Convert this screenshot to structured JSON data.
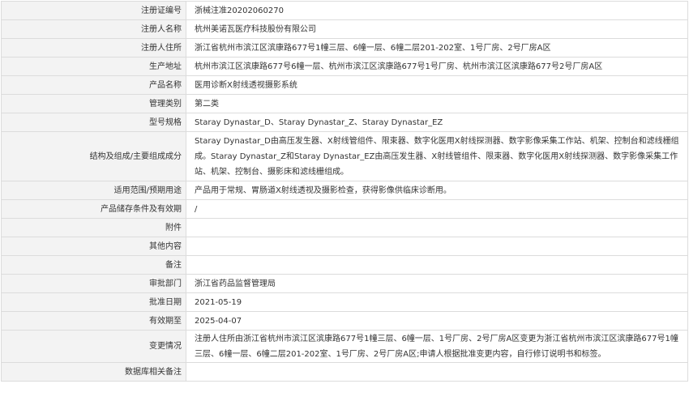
{
  "rows": [
    {
      "label": "注册证编号",
      "value": "浙械注准20202060270"
    },
    {
      "label": "注册人名称",
      "value": "杭州美诺瓦医疗科技股份有限公司"
    },
    {
      "label": "注册人住所",
      "value": "浙江省杭州市滨江区滨康路677号1幢三层、6幢一层、6幢二层201-202室、1号厂房、2号厂房A区"
    },
    {
      "label": "生产地址",
      "value": "杭州市滨江区滨康路677号6幢一层、杭州市滨江区滨康路677号1号厂房、杭州市滨江区滨康路677号2号厂房A区"
    },
    {
      "label": "产品名称",
      "value": "医用诊断X射线透视摄影系统"
    },
    {
      "label": "管理类别",
      "value": "第二类"
    },
    {
      "label": "型号规格",
      "value": "Staray Dynastar_D、Staray Dynastar_Z、Staray Dynastar_EZ"
    },
    {
      "label": "结构及组成/主要组成成分",
      "value": "Staray Dynastar_D由高压发生器、X射线管组件、限束器、数字化医用X射线探测器、数字影像采集工作站、机架、控制台和滤线栅组成。Staray Dynastar_Z和Staray Dynastar_EZ由高压发生器、X射线管组件、限束器、数字化医用X射线探测器、数字影像采集工作站、机架、控制台、摄影床和滤线栅组成。"
    },
    {
      "label": "适用范围/预期用途",
      "value": "产品用于常规、胃肠道X射线透视及摄影检查，获得影像供临床诊断用。"
    },
    {
      "label": "产品储存条件及有效期",
      "value": "/"
    },
    {
      "label": "附件",
      "value": ""
    },
    {
      "label": "其他内容",
      "value": ""
    },
    {
      "label": "备注",
      "value": ""
    },
    {
      "label": "审批部门",
      "value": "浙江省药品监督管理局"
    },
    {
      "label": "批准日期",
      "value": "2021-05-19"
    },
    {
      "label": "有效期至",
      "value": "2025-04-07"
    },
    {
      "label": "变更情况",
      "value": "注册人住所由浙江省杭州市滨江区滨康路677号1幢三层、6幢一层、1号厂房、2号厂房A区变更为浙江省杭州市滨江区滨康路677号1幢三层、6幢一层、6幢二层201-202室、1号厂房、2号厂房A区;申请人根据批准变更内容，自行修订说明书和标签。"
    },
    {
      "label": "数据库相关备注",
      "value": ""
    }
  ]
}
